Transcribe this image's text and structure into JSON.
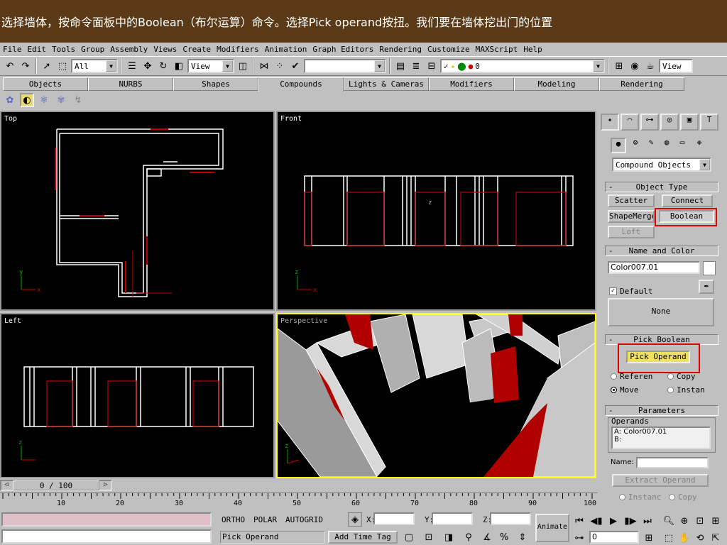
{
  "caption": "选择墙体，按命令面板中的Boolean（布尔运算）命令。选择Pick operand按扭。我们要在墙体挖出门的位置",
  "menu": [
    "File",
    "Edit",
    "Tools",
    "Group",
    "Assembly",
    "Views",
    "Create",
    "Modifiers",
    "Animation",
    "Graph Editors",
    "Rendering",
    "Customize",
    "MAXScript",
    "Help"
  ],
  "toolbar": {
    "selection_filter": "All",
    "ref_coord": "View",
    "named_sel": "",
    "layer_value": "0",
    "view_right": "View"
  },
  "tabs": [
    "Objects",
    "NURBS",
    "Shapes",
    "Compounds",
    "Lights & Cameras",
    "Modifiers",
    "Modeling",
    "Rendering"
  ],
  "active_tab": "Compounds",
  "viewports": {
    "top": "Top",
    "front": "Front",
    "left": "Left",
    "perspective": "Perspective"
  },
  "axis": {
    "x": "x",
    "y": "y",
    "z": "z"
  },
  "panel": {
    "category": "Compound Objects",
    "object_type": {
      "header": "Object Type",
      "scatter": "Scatter",
      "connect": "Connect",
      "shapemerge": "ShapeMerge",
      "boolean": "Boolean",
      "loft": "Loft"
    },
    "name_color": {
      "header": "Name and Color",
      "name_value": "Color007.01",
      "default_label": "Default",
      "none_button": "None"
    },
    "pick_boolean": {
      "header": "Pick Boolean",
      "pick_operand": "Pick Operand",
      "reference": "Referen",
      "copy": "Copy",
      "move": "Move",
      "instance": "Instan"
    },
    "parameters": {
      "header": "Parameters",
      "operands_label": "Operands",
      "operand_a": "A: Color007.01",
      "operand_b": "B:",
      "name_label": "Name:",
      "extract_button": "Extract Operand",
      "instance": "Instanc",
      "copy": "Copy"
    },
    "collapse": "-"
  },
  "timeline": {
    "frame": "0 / 100",
    "ticks": [
      "10",
      "20",
      "30",
      "40",
      "50",
      "60",
      "70",
      "80",
      "90",
      "100"
    ]
  },
  "status": {
    "ortho": "ORTHO",
    "polar": "POLAR",
    "autogrid": "AUTOGRID",
    "x": "X:",
    "y": "Y:",
    "z": "Z:",
    "prompt": "Pick Operand",
    "add_time_tag": "Add Time Tag",
    "animate": "Animate",
    "frame": "0"
  },
  "colors": {
    "caption_bg": "#5a3a16",
    "highlight": "#e00000",
    "door_red": "#b00000",
    "selected_yellow": "#ffff00"
  }
}
